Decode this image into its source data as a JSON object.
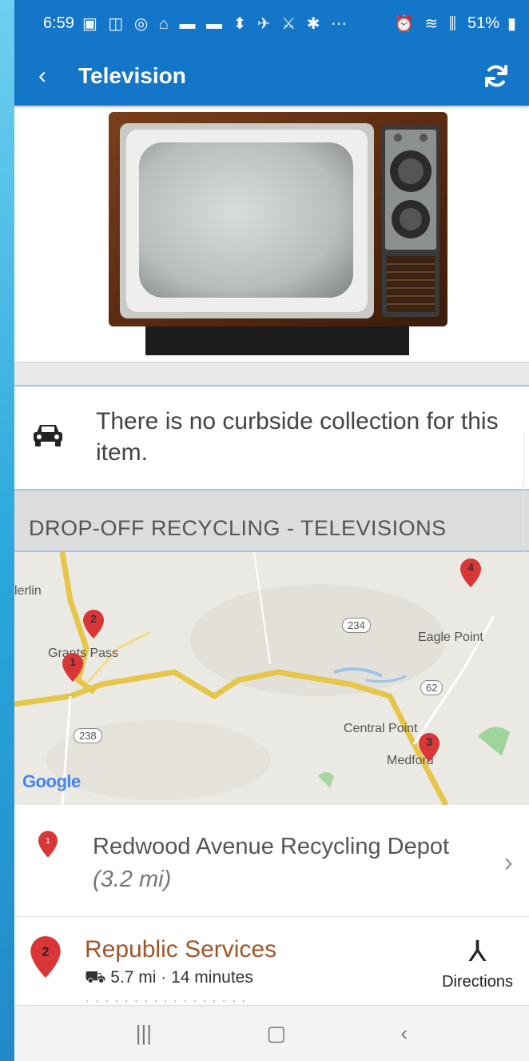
{
  "status_bar": {
    "time": "6:59",
    "icons_left": "▣ ◫ ◎ ⌂ ▬ ▬ ⬍ ✈ ⚔ ✱ ⋯",
    "icons_right": "⏰ ≋ ⫼",
    "battery": "51%"
  },
  "app_bar": {
    "title": "Television",
    "back_icon": "back-arrow-icon",
    "refresh_icon": "refresh-icon"
  },
  "curbside": {
    "message": "There is no curbside collection for this item."
  },
  "section": {
    "title": "DROP-OFF RECYCLING - TELEVISIONS"
  },
  "map": {
    "labels": {
      "merlin": "lerlin",
      "grants_pass": "Grants Pass",
      "eagle_point": "Eagle Point",
      "central_point": "Central Point",
      "medford": "Medford"
    },
    "routes": {
      "r234": "234",
      "r62": "62",
      "r238": "238"
    },
    "pins": [
      "1",
      "2",
      "3",
      "4"
    ],
    "attribution": "Google"
  },
  "locations": [
    {
      "pin": "1",
      "name": "Redwood Avenue Recycling Depot",
      "distance": "(3.2 mi)"
    },
    {
      "pin": "2",
      "name": "Republic Services",
      "drive": "5.7 mi  · 14 minutes",
      "directions_label": "Directions"
    }
  ],
  "colors": {
    "primary": "#1476c9",
    "pin_red": "#d93737",
    "link_brown": "#a0552a"
  }
}
